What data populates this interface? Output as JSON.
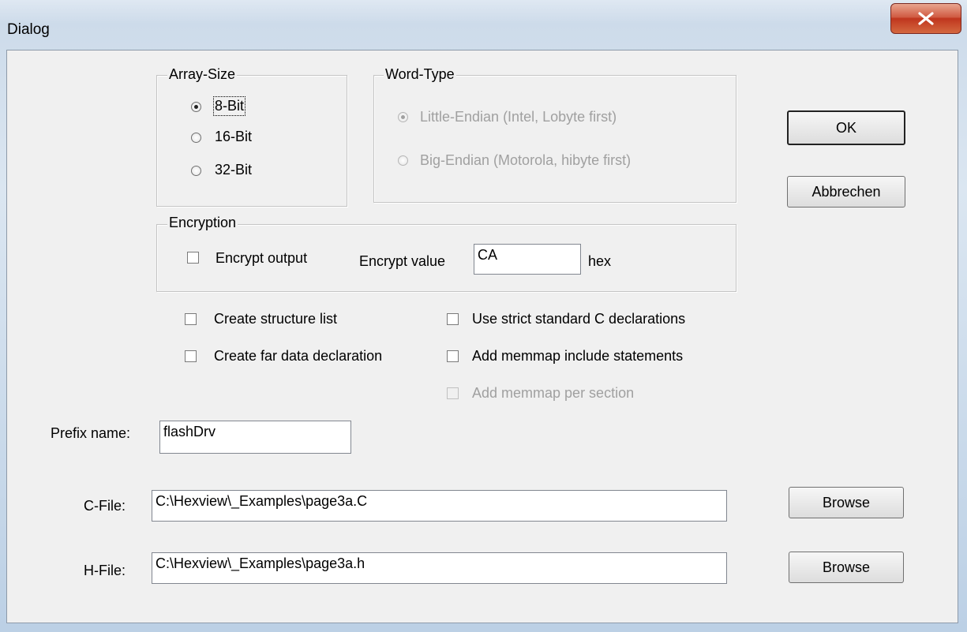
{
  "window": {
    "title": "Dialog"
  },
  "array_size": {
    "legend": "Array-Size",
    "options": [
      {
        "label": "8-Bit",
        "selected": true
      },
      {
        "label": "16-Bit",
        "selected": false
      },
      {
        "label": "32-Bit",
        "selected": false
      }
    ]
  },
  "word_type": {
    "legend": "Word-Type",
    "options": [
      {
        "label": "Little-Endian (Intel, Lobyte first)",
        "selected": true,
        "enabled": false
      },
      {
        "label": "Big-Endian (Motorola, hibyte first)",
        "selected": false,
        "enabled": false
      }
    ]
  },
  "encryption": {
    "legend": "Encryption",
    "encrypt_output_label": "Encrypt output",
    "encrypt_output_checked": false,
    "encrypt_value_label": "Encrypt value",
    "encrypt_value": "CA",
    "unit": "hex"
  },
  "options": {
    "create_structure_list": {
      "label": "Create structure list",
      "checked": false
    },
    "create_far_data": {
      "label": "Create far data declaration",
      "checked": false
    },
    "strict_c": {
      "label": "Use strict standard C declarations",
      "checked": false
    },
    "memmap_include": {
      "label": "Add memmap include statements",
      "checked": false
    },
    "memmap_per_section": {
      "label": "Add memmap per section",
      "checked": false,
      "enabled": false
    }
  },
  "prefix": {
    "label": "Prefix name:",
    "value": "flashDrv"
  },
  "c_file": {
    "label": "C-File:",
    "value": "C:\\Hexview\\_Examples\\page3a.C",
    "browse_label": "Browse"
  },
  "h_file": {
    "label": "H-File:",
    "value": "C:\\Hexview\\_Examples\\page3a.h",
    "browse_label": "Browse"
  },
  "buttons": {
    "ok": "OK",
    "cancel": "Abbrechen"
  },
  "icons": {
    "close": "close-x-icon"
  }
}
